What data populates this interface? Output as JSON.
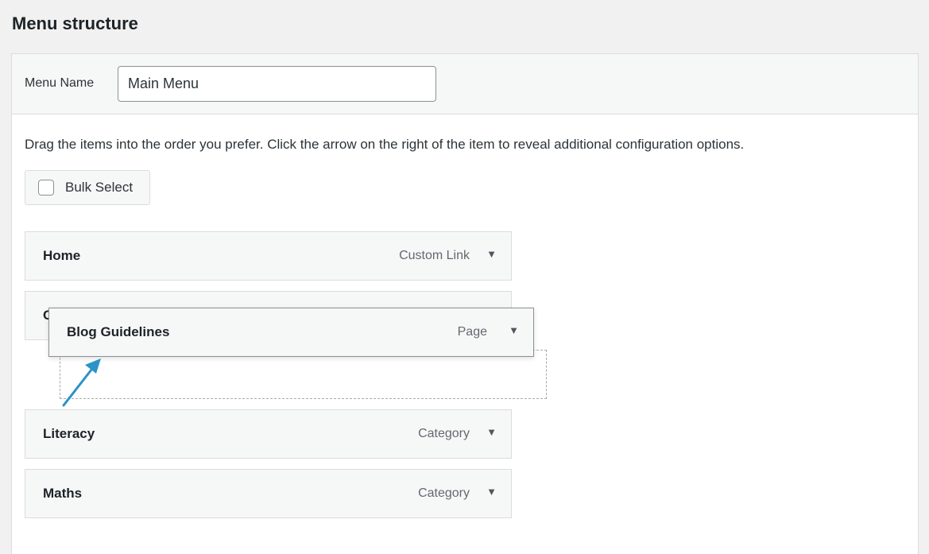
{
  "page": {
    "title": "Menu structure"
  },
  "menu_name": {
    "label": "Menu Name",
    "value": "Main Menu"
  },
  "instructions": "Drag the items into the order you prefer. Click the arrow on the right of the item to reveal additional configuration options.",
  "bulk_select": {
    "label": "Bulk Select",
    "checked": false
  },
  "menu_items": [
    {
      "title": "Home",
      "type": "Custom Link"
    },
    {
      "title": "C",
      "type": ""
    },
    {
      "title": "Literacy",
      "type": "Category"
    },
    {
      "title": "Maths",
      "type": "Category"
    }
  ],
  "dragging_item": {
    "title": "Blog Guidelines",
    "type": "Page"
  },
  "arrow_glyph": "▼",
  "colors": {
    "annotation_arrow": "#2a93c7",
    "background": "#f1f1f1",
    "panel": "#f6f7f7"
  }
}
